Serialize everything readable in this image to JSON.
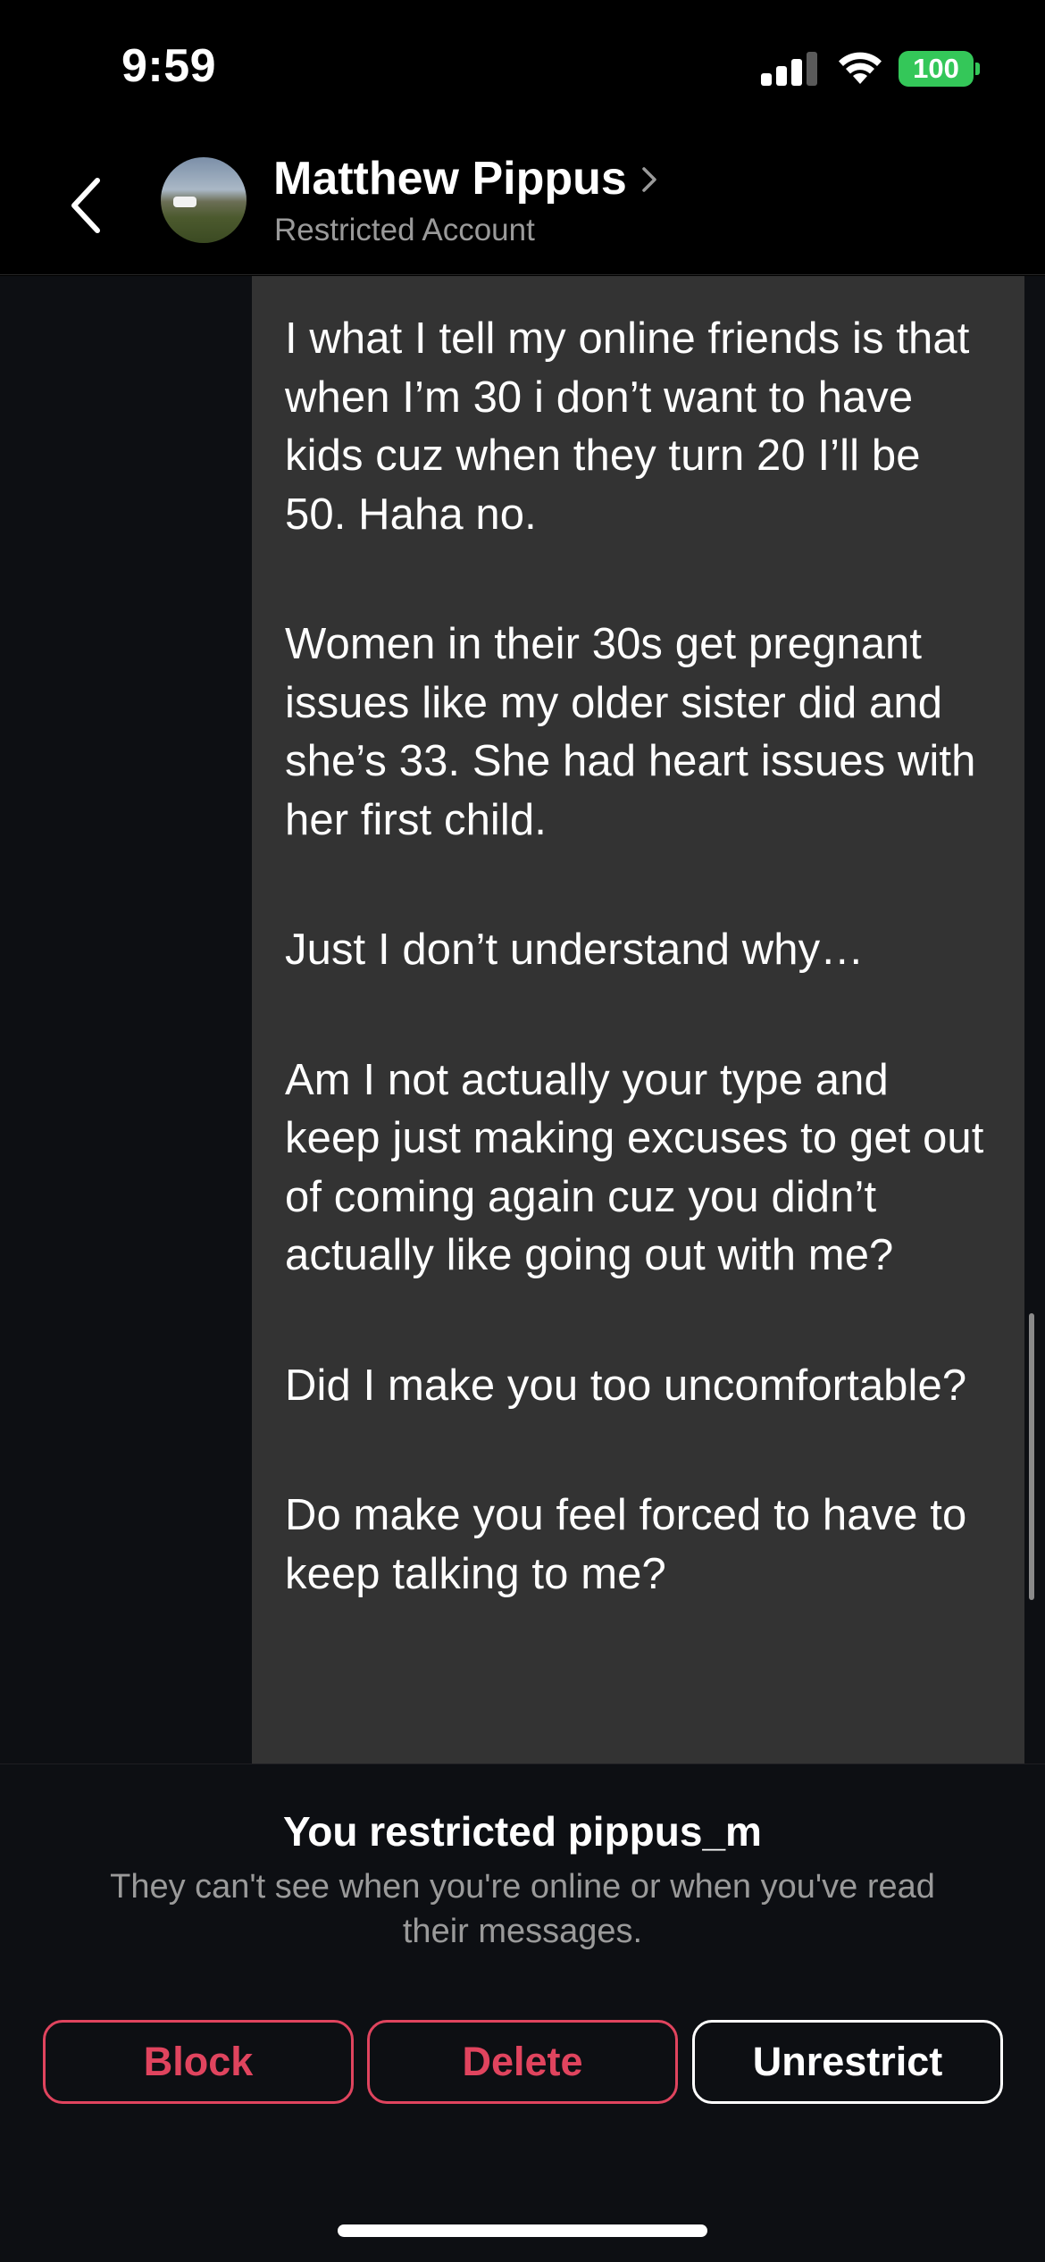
{
  "status_bar": {
    "time": "9:59",
    "battery_level": "100",
    "signal_bars_active": 3,
    "signal_bars_total": 4
  },
  "header": {
    "contact_name": "Matthew Pippus",
    "subtitle": "Restricted Account",
    "icons": [
      "chevron-left-icon",
      "chevron-right-icon"
    ]
  },
  "messages": [
    {
      "paragraphs": [
        "I what I tell my online friends is that when I’m 30 i don’t want to have kids cuz when they turn 20 I’ll be 50. Haha no.",
        "Women in their 30s get pregnant issues like my older sister did and she’s 33. She had heart issues with her first child.",
        "Just I don’t understand why…",
        "Am I not actually your type and keep just making excuses to get out of coming again cuz you didn’t actually like going out with me?",
        "Did I make you too uncomfortable?",
        "Do make you feel forced to have to keep talking to me?"
      ]
    }
  ],
  "restriction_panel": {
    "title": "You restricted pippus_m",
    "description": "They can't see when you're online or when you've read their messages.",
    "buttons": {
      "block": "Block",
      "delete": "Delete",
      "unrestrict": "Unrestrict"
    }
  },
  "colors": {
    "danger": "#e0445e",
    "battery": "#34c759",
    "bubble": "#333333",
    "chat_background": "#0d0f13"
  }
}
